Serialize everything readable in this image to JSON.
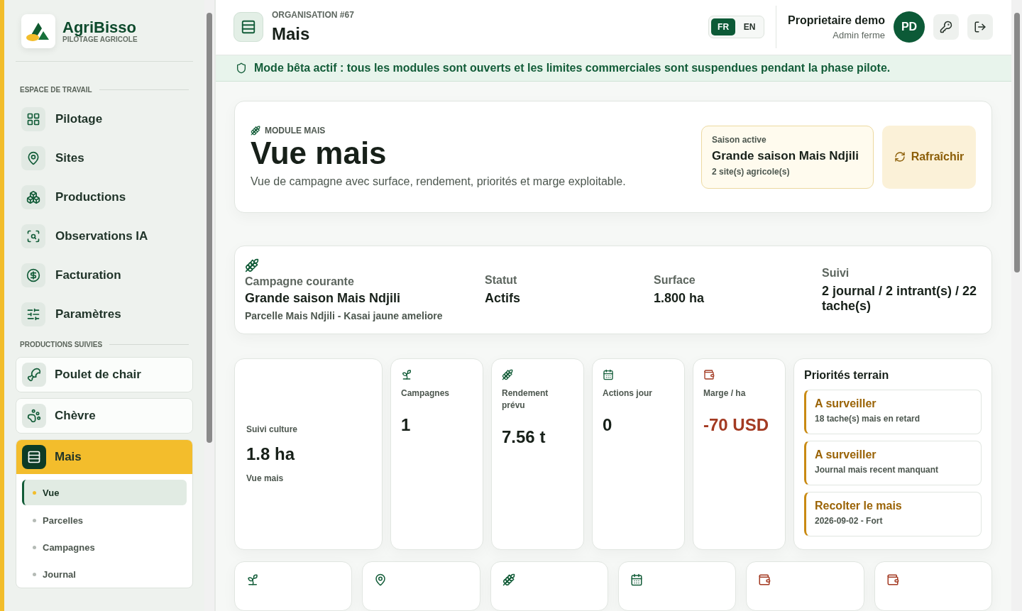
{
  "sidebar": {
    "brand": {
      "name": "AgriBisso",
      "tagline": "PILOTAGE AGRICOLE"
    },
    "workspace": {
      "title": "ESPACE DE TRAVAIL",
      "items": [
        {
          "label": "Pilotage",
          "selected": false
        },
        {
          "label": "Sites",
          "selected": false
        },
        {
          "label": "Productions",
          "selected": false
        },
        {
          "label": "Observations IA",
          "selected": false
        },
        {
          "label": "Facturation",
          "selected": false
        },
        {
          "label": "Paramètres",
          "selected": false
        }
      ]
    },
    "productions": {
      "title": "PRODUCTIONS SUIVIES",
      "items": [
        {
          "label": "Poulet de chair",
          "selected": false
        },
        {
          "label": "Chèvre",
          "selected": false
        },
        {
          "label": "Mais",
          "selected": true,
          "children": [
            {
              "label": "Vue",
              "selected": true
            },
            {
              "label": "Parcelles",
              "selected": false
            },
            {
              "label": "Campagnes",
              "selected": false
            },
            {
              "label": "Journal",
              "selected": false
            }
          ]
        }
      ]
    }
  },
  "header": {
    "organisation": "ORGANISATION #67",
    "title": "Mais",
    "languages": [
      {
        "label": "FR",
        "selected": true
      },
      {
        "label": "EN",
        "selected": false
      }
    ],
    "user": {
      "name": "Proprietaire demo",
      "role": "Admin ferme",
      "initials": "PD"
    }
  },
  "banner": "Mode bêta actif : tous les modules sont ouverts et les limites commerciales sont suspendues pendant la phase pilote.",
  "hero": {
    "eyebrow": "MODULE MAIS",
    "title": "Vue mais",
    "description": "Vue de campagne avec surface, rendement, priorités et marge exploitable.",
    "season": {
      "label": "Saison active",
      "name": "Grande saison Mais Ndjili",
      "sites": "2 site(s) agricole(s)"
    },
    "refresh": "Rafraîchir"
  },
  "campaign": {
    "label": "Campagne courante",
    "name": "Grande saison Mais Ndjili",
    "detail": "Parcelle Mais Ndjili - Kasai jaune ameliore",
    "fields": [
      {
        "label": "Statut",
        "value": "Actifs"
      },
      {
        "label": "Surface",
        "value": "1.800 ha"
      },
      {
        "label": "Suivi",
        "value": "2 journal / 2 intrant(s) / 22 tache(s)"
      }
    ]
  },
  "stats": [
    {
      "kind": "summary",
      "label": "Suivi culture",
      "value": "1.8 ha",
      "note": "Vue mais",
      "negative": false
    },
    {
      "kind": "metric",
      "label": "Campagnes",
      "value": "1",
      "negative": false
    },
    {
      "kind": "metric",
      "label": "Rendement prévu",
      "value": "7.56 t",
      "negative": false
    },
    {
      "kind": "metric",
      "label": "Actions jour",
      "value": "0",
      "negative": false
    },
    {
      "kind": "metric",
      "label": "Marge / ha",
      "value": "-70 USD",
      "negative": true
    }
  ],
  "priorities": {
    "title": "Priorités terrain",
    "items": [
      {
        "title": "A surveiller",
        "detail": "18 tache(s) mais en retard"
      },
      {
        "title": "A surveiller",
        "detail": "Journal mais recent manquant"
      },
      {
        "title": "Recolter le mais",
        "detail": "2026-09-02 - Fort"
      }
    ]
  }
}
